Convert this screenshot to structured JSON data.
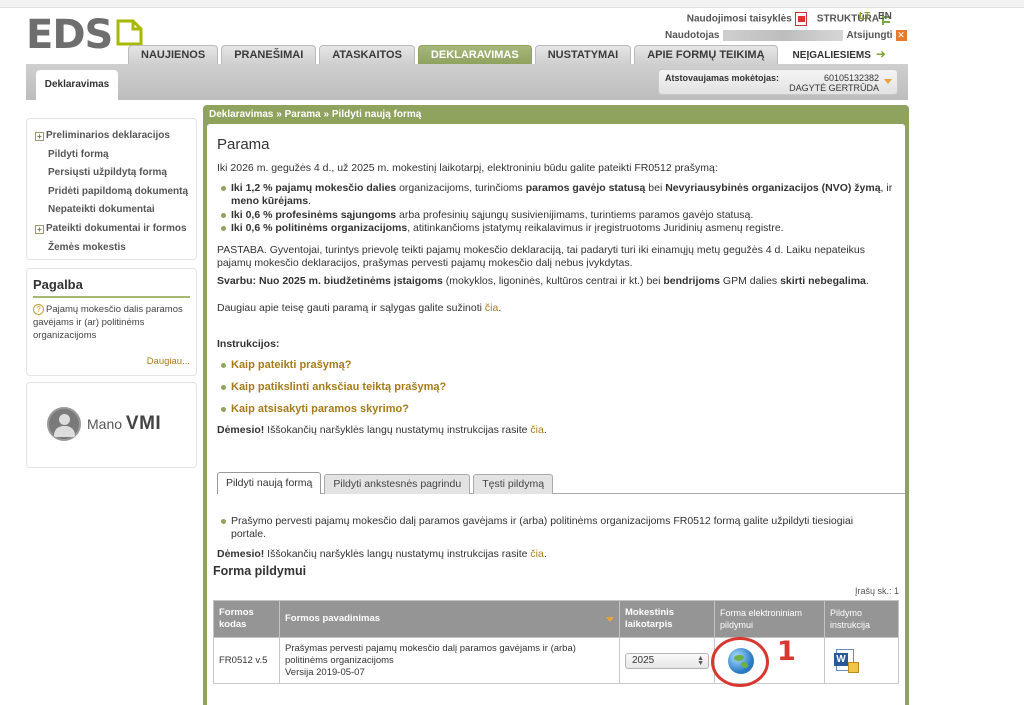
{
  "header": {
    "logo_text": "EDS",
    "links": {
      "rules": "Naudojimosi taisyklės",
      "structure": "STRUKTŪRA"
    },
    "lang": {
      "lt": "LT",
      "en": "EN"
    },
    "user_label": "Naudotojas",
    "logout": "Atsijungti"
  },
  "nav": {
    "tabs": [
      "NAUJIENOS",
      "PRANEŠIMAI",
      "ATASKAITOS",
      "DEKLARAVIMAS",
      "NUSTATYMAI",
      "APIE FORMŲ TEIKIMĄ"
    ],
    "active_index": 3,
    "accessibility": "NEĮGALIESIEMS"
  },
  "subbar": {
    "tab": "Deklaravimas",
    "payer_label": "Atstovaujamas mokėtojas:",
    "payer_code": "60105132382",
    "payer_name": "DAGYTĖ GERTRŪDA"
  },
  "sidebar": {
    "items": [
      {
        "label": "Preliminarios deklaracijos",
        "expand": true
      },
      {
        "label": "Pildyti formą",
        "expand": false
      },
      {
        "label": "Persiųsti užpildytą formą",
        "expand": false
      },
      {
        "label": "Pridėti papildomą dokumentą",
        "expand": false
      },
      {
        "label": "Nepateikti dokumentai",
        "expand": false
      },
      {
        "label": "Pateikti dokumentai ir formos",
        "expand": true
      },
      {
        "label": "Žemės mokestis",
        "expand": false
      }
    ],
    "help_title": "Pagalba",
    "help_text": "Pajamų mokesčio dalis paramos gavėjams ir (ar) politinėms organizacijoms",
    "help_more": "Daugiau...",
    "vmi_prefix": "Mano",
    "vmi_brand": "VMI"
  },
  "main": {
    "breadcrumb": "Deklaravimas » Parama » Pildyti naują formą",
    "title": "Parama",
    "intro": "Iki 2026 m. gegužės 4 d., už 2025 m. mokestinį laikotarpį, elektroniniu būdu galite pateikti FR0512 prašymą:",
    "b1_a": "Iki 1,2 % pajamų mokesčio dalies",
    "b1_b": " organizacijoms, turinčioms ",
    "b1_c": "paramos gavėjo statusą",
    "b1_d": " bei ",
    "b1_e": "Nevyriausybinės organizacijos (NVO) žymą",
    "b1_f": ", ir ",
    "b1_g": "meno kūrėjams",
    "b1_h": ".",
    "b2_a": "Iki 0,6 % profesinėms sąjungoms",
    "b2_b": " arba profesinių sąjungų susivienijimams, turintiems paramos gavėjo statusą.",
    "b3_a": "Iki 0,6 % politinėms organizacijoms",
    "b3_b": ", atitinkančioms įstatymų reikalavimus ir įregistruotoms Juridinių asmenų registre.",
    "note": "PASTABA. Gyventojai, turintys prievolę teikti pajamų mokesčio deklaraciją, tai padaryti turi iki einamųjų metų gegužės 4 d. Laiku nepateikus pajamų mokesčio deklaracijos, prašymas pervesti pajamų mokesčio dalį nebus įvykdytas.",
    "imp_a": "Svarbu: Nuo 2025 m. biudžetinėms įstaigoms",
    "imp_b": " (mokyklos, ligoninės, kultūros centrai ir kt.) bei ",
    "imp_c": "bendrijoms",
    "imp_d": " GPM dalies ",
    "imp_e": "skirti nebegalima",
    "imp_f": ".",
    "more_a": "Daugiau apie teisę gauti paramą ir sąlygas galite sužinoti ",
    "here": "čia",
    "dot": ".",
    "instr_title": "Instrukcijos:",
    "instr": [
      "Kaip pateikti prašymą?",
      "Kaip patikslinti anksčiau teiktą prašymą?",
      "Kaip atsisakyti paramos skyrimo?"
    ],
    "warn_label": "Dėmesio!",
    "warn_text": " Iššokančių naršyklės langų nustatymų instrukcijas rasite ",
    "tabs": [
      "Pildyti naują formą",
      "Pildyti ankstesnės pagrindu",
      "Tęsti pildymą"
    ],
    "tab_bullet": "Prašymo pervesti pajamų mokesčio dalį paramos gavėjams ir (arba) politinėms organizacijoms FR0512 formą galite užpildyti tiesiogiai portale.",
    "forms_title": "Forma pildymui",
    "records": "Įrašų sk.: 1"
  },
  "table": {
    "headers": {
      "code": "Formos kodas",
      "name": "Formos pavadinimas",
      "period": "Mokestinis laikotarpis",
      "electronic": "Forma elektroniniam pildymui",
      "instruction": "Pildymo instrukcija"
    },
    "row": {
      "code": "FR0512 v.5",
      "name": "Prašymas pervesti pajamų mokesčio dalį paramos gavėjams ir (arba) politinėms organizacijoms",
      "version": "Versija 2019-05-07",
      "year": "2025"
    }
  },
  "annotation": {
    "number": "1",
    "color": "#d9362f"
  },
  "colors": {
    "accent": "#8fa25e",
    "link": "#a67c1a",
    "header_grey": "#959595"
  }
}
